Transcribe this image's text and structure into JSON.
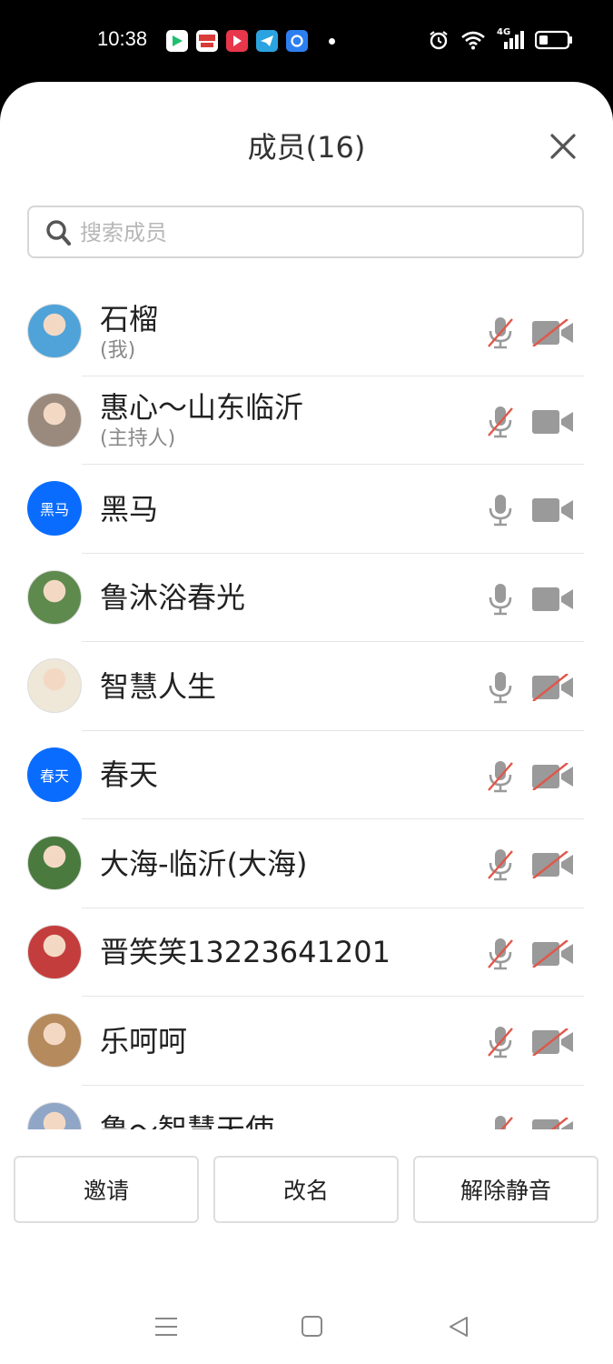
{
  "status_bar": {
    "time": "10:38",
    "app_icons": [
      "play-store-icon",
      "news-app-icon",
      "video-app-icon",
      "telegram-icon",
      "browser-app-icon"
    ],
    "right_icons": [
      "alarm-icon",
      "wifi-icon",
      "4g-signal-icon",
      "battery-icon"
    ],
    "network_label": "4G"
  },
  "panel": {
    "title": "成员(16)",
    "search_placeholder": "搜索成员"
  },
  "members": [
    {
      "name": "石榴",
      "role": "(我)",
      "avatar_type": "photo",
      "avatar_color": "#4fa3d9",
      "mic_muted": true,
      "cam_off": true
    },
    {
      "name": "惠心～山东临沂",
      "role": "(主持人)",
      "avatar_type": "photo",
      "avatar_color": "#9a8a7d",
      "mic_muted": true,
      "cam_off": false
    },
    {
      "name": "黑马",
      "role": "",
      "avatar_type": "text",
      "avatar_text": "黑马",
      "mic_muted": false,
      "cam_off": false
    },
    {
      "name": "鲁沐浴春光",
      "role": "",
      "avatar_type": "photo",
      "avatar_color": "#5e8a4d",
      "mic_muted": false,
      "cam_off": false
    },
    {
      "name": "智慧人生",
      "role": "",
      "avatar_type": "photo",
      "avatar_color": "#efe8d8",
      "mic_muted": false,
      "cam_off": true
    },
    {
      "name": "春天",
      "role": "",
      "avatar_type": "text",
      "avatar_text": "春天",
      "mic_muted": true,
      "cam_off": true
    },
    {
      "name": "大海-临沂(大海)",
      "role": "",
      "avatar_type": "photo",
      "avatar_color": "#4a7a3e",
      "mic_muted": true,
      "cam_off": true
    },
    {
      "name": "晋笑笑13223641201",
      "role": "",
      "avatar_type": "photo",
      "avatar_color": "#c43d3d",
      "mic_muted": true,
      "cam_off": true
    },
    {
      "name": "乐呵呵",
      "role": "",
      "avatar_type": "photo",
      "avatar_color": "#b58a5c",
      "mic_muted": true,
      "cam_off": true
    },
    {
      "name": "鲁～智慧天使",
      "role": "",
      "avatar_type": "photo",
      "avatar_color": "#8fa6c7",
      "mic_muted": true,
      "cam_off": true
    }
  ],
  "actions": {
    "invite": "邀请",
    "rename": "改名",
    "unmute": "解除静音"
  },
  "colors": {
    "accent": "#0a6cff",
    "icon_gray": "#9a9a9a",
    "muted_slash": "#e0574a"
  }
}
